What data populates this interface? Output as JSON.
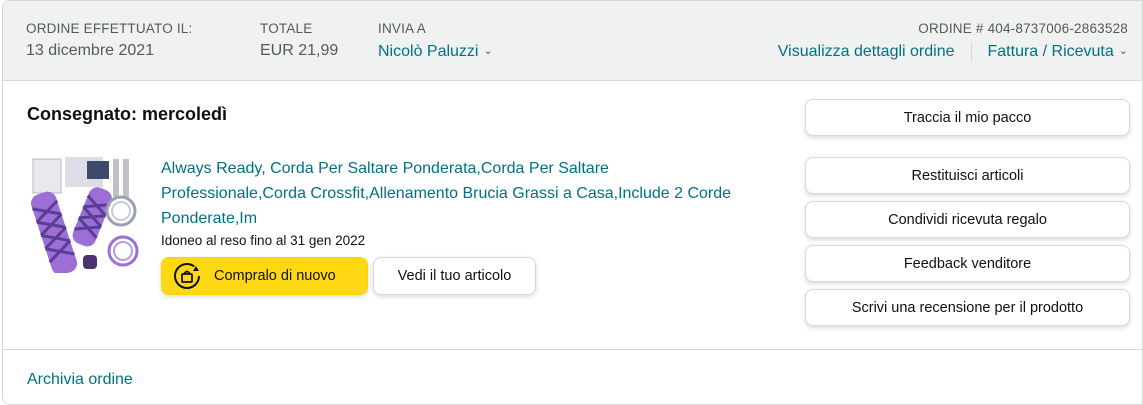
{
  "header": {
    "order_placed_label": "ORDINE EFFETTUATO IL:",
    "order_placed_value": "13 dicembre 2021",
    "total_label": "TOTALE",
    "total_value": "EUR 21,99",
    "ship_to_label": "INVIA A",
    "ship_to_value": "Nicolò Paluzzi",
    "order_number": "ORDINE # 404-8737006-2863528",
    "view_details": "Visualizza dettagli ordine",
    "invoice": "Fattura / Ricevuta"
  },
  "shipment": {
    "status": "Consegnato: mercoledì"
  },
  "item": {
    "title": "Always Ready, Corda Per Saltare Ponderata,Corda Per Saltare Professionale,Corda Crossfit,Allenamento Brucia Grassi a Casa,Include 2 Corde Ponderate,Im",
    "return_info": "Idoneo al reso fino al 31 gen 2022",
    "buy_again": "Compralo di nuovo",
    "view_item": "Vedi il tuo articolo"
  },
  "actions": {
    "track": "Traccia il mio pacco",
    "return_items": "Restituisci articoli",
    "gift_receipt": "Condividi ricevuta regalo",
    "seller_feedback": "Feedback venditore",
    "write_review": "Scrivi una recensione per il prodotto"
  },
  "footer": {
    "archive": "Archivia ordine"
  },
  "colors": {
    "link": "#007185",
    "header_bg": "#f0f2f2",
    "buy_button": "#ffd814",
    "border": "#d5d9d9",
    "product_purple": "#9b6fd6"
  },
  "icons": [
    "chevron-down-icon",
    "buy-again-icon",
    "product-image"
  ]
}
